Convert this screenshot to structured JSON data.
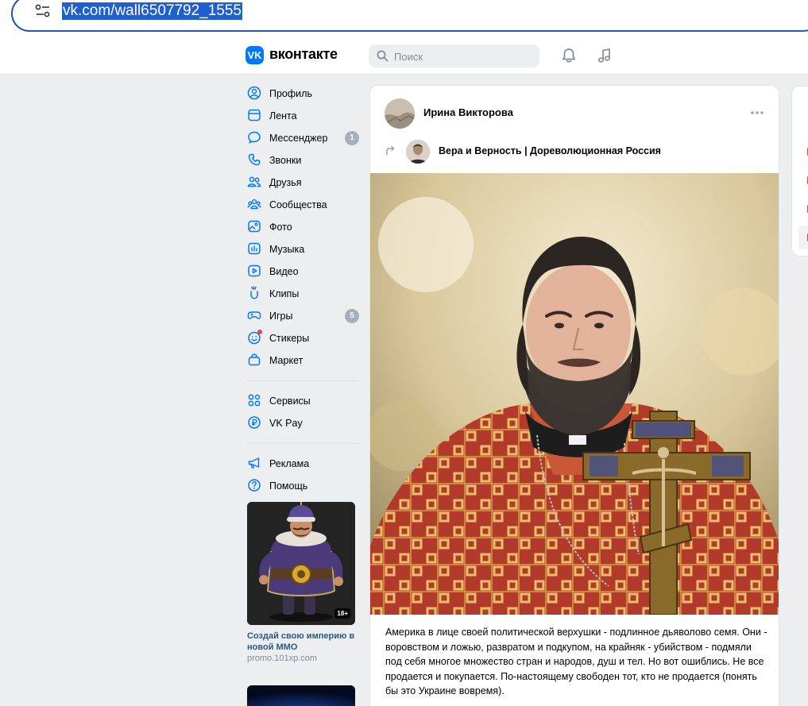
{
  "browser": {
    "url": "vk.com/wall6507792_1555"
  },
  "header": {
    "logo_letters": "VK",
    "brand": "вконтакте",
    "search_placeholder": "Поиск"
  },
  "nav": {
    "items": [
      {
        "label": "Профиль",
        "icon": "user-circle-icon"
      },
      {
        "label": "Лента",
        "icon": "newsfeed-icon"
      },
      {
        "label": "Мессенджер",
        "icon": "message-icon",
        "badge": "1"
      },
      {
        "label": "Звонки",
        "icon": "phone-icon"
      },
      {
        "label": "Друзья",
        "icon": "friends-icon"
      },
      {
        "label": "Сообщества",
        "icon": "communities-icon"
      },
      {
        "label": "Фото",
        "icon": "photo-icon"
      },
      {
        "label": "Музыка",
        "icon": "music-icon"
      },
      {
        "label": "Видео",
        "icon": "video-icon"
      },
      {
        "label": "Клипы",
        "icon": "clips-icon"
      },
      {
        "label": "Игры",
        "icon": "gamepad-icon",
        "badge": "5"
      },
      {
        "label": "Стикеры",
        "icon": "sticker-icon"
      },
      {
        "label": "Маркет",
        "icon": "market-bag-icon"
      }
    ],
    "items2": [
      {
        "label": "Сервисы",
        "icon": "services-grid-icon"
      },
      {
        "label": "VK Pay",
        "icon": "vkpay-icon"
      }
    ],
    "items3": [
      {
        "label": "Реклама",
        "icon": "megaphone-icon"
      },
      {
        "label": "Помощь",
        "icon": "help-icon"
      }
    ]
  },
  "ad": {
    "title": "Создай свою империю в новой MMO",
    "domain": "promo.101xp.com",
    "age": "18+"
  },
  "post": {
    "author": "Ирина Викторова",
    "repost_source": "Вера и Верность | Дореволюционная Россия",
    "text": "Америка в лице своей политической верхушки - подлинное дьяволово семя. Они - воровством и ложью, развратом и подкупом, на крайняк - убийством - подмяли под себя многое множество стран и народов, душ и тел. Но вот ошиблись. Не все продается и покупается. По-настоящему свободен тот, кто не продается (понять бы это Украине вовремя)."
  },
  "colors": {
    "accent": "#0077ff",
    "link": "#2a5885",
    "background": "#edeef0",
    "badge": "#a6afbb"
  }
}
